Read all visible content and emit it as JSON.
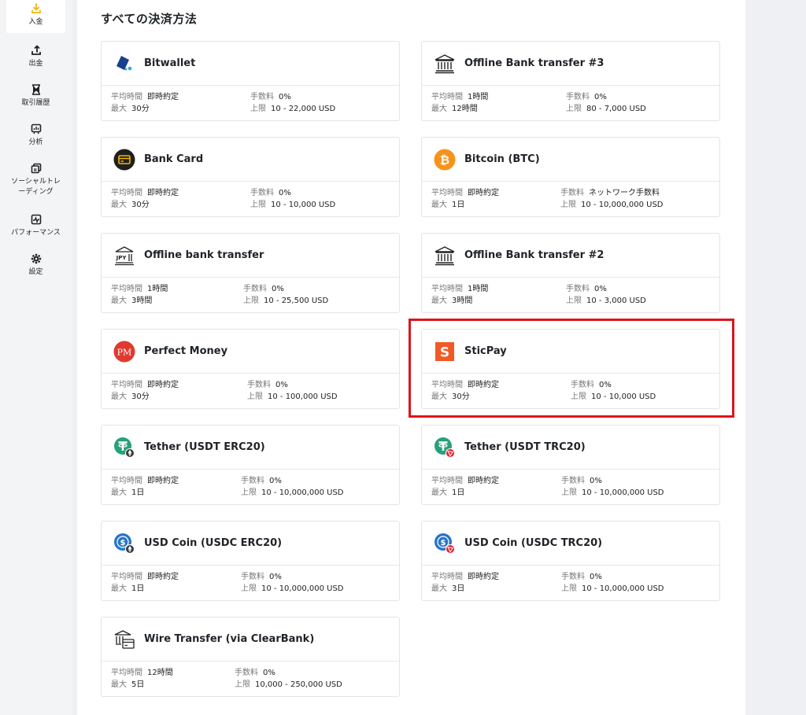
{
  "sidebar": {
    "items": [
      {
        "label": "入金",
        "icon": "download-icon"
      },
      {
        "label": "出金",
        "icon": "upload-icon"
      },
      {
        "label": "取引履歴",
        "icon": "hourglass-icon"
      },
      {
        "label": "分析",
        "icon": "chart-icon"
      },
      {
        "label": "ソーシャルトレーディング",
        "icon": "copy-icon"
      },
      {
        "label": "パフォーマンス",
        "icon": "performance-icon"
      },
      {
        "label": "設定",
        "icon": "gear-icon"
      }
    ]
  },
  "main": {
    "title": "すべての決済方法",
    "field_labels": {
      "avg_time": "平均時間",
      "max": "最大",
      "fee": "手数料",
      "limit": "上限"
    },
    "methods": [
      {
        "name": "Bitwallet",
        "avg_time": "即時約定",
        "max": "30分",
        "fee": "0%",
        "limit": "10 - 22,000 USD"
      },
      {
        "name": "Offline Bank transfer #3",
        "avg_time": "1時間",
        "max": "12時間",
        "fee": "0%",
        "limit": "80 - 7,000 USD"
      },
      {
        "name": "Bank Card",
        "avg_time": "即時約定",
        "max": "30分",
        "fee": "0%",
        "limit": "10 - 10,000 USD"
      },
      {
        "name": "Bitcoin (BTC)",
        "avg_time": "即時約定",
        "max": "1日",
        "fee": "ネットワーク手数料",
        "limit": "10 - 10,000,000 USD"
      },
      {
        "name": "Offline bank transfer",
        "avg_time": "1時間",
        "max": "3時間",
        "fee": "0%",
        "limit": "10 - 25,500 USD",
        "logo_text": "JPY"
      },
      {
        "name": "Offline Bank transfer #2",
        "avg_time": "1時間",
        "max": "3時間",
        "fee": "0%",
        "limit": "10 - 3,000 USD"
      },
      {
        "name": "Perfect Money",
        "avg_time": "即時約定",
        "max": "30分",
        "fee": "0%",
        "limit": "10 - 100,000 USD",
        "logo_text": "PM"
      },
      {
        "name": "SticPay",
        "avg_time": "即時約定",
        "max": "30分",
        "fee": "0%",
        "limit": "10 - 10,000 USD",
        "logo_text": "S"
      },
      {
        "name": "Tether (USDT ERC20)",
        "avg_time": "即時約定",
        "max": "1日",
        "fee": "0%",
        "limit": "10 - 10,000,000 USD"
      },
      {
        "name": "Tether (USDT TRC20)",
        "avg_time": "即時約定",
        "max": "1日",
        "fee": "0%",
        "limit": "10 - 10,000,000 USD"
      },
      {
        "name": "USD Coin (USDC ERC20)",
        "avg_time": "即時約定",
        "max": "1日",
        "fee": "0%",
        "limit": "10 - 10,000,000 USD"
      },
      {
        "name": "USD Coin (USDC TRC20)",
        "avg_time": "即時約定",
        "max": "3日",
        "fee": "0%",
        "limit": "10 - 10,000,000 USD"
      },
      {
        "name": "Wire Transfer (via ClearBank)",
        "avg_time": "12時間",
        "max": "5日",
        "fee": "0%",
        "limit": "10,000 - 250,000 USD"
      }
    ]
  },
  "colors": {
    "accent": "#f2b705",
    "highlight_border": "#e0131b",
    "bitwallet": "#1b3f8f",
    "bitcoin": "#f7931a",
    "perfect_money": "#e03a2f",
    "sticpay": "#f15a24",
    "tether": "#26a17b",
    "usdc": "#2775ca",
    "tron": "#e5202e"
  }
}
